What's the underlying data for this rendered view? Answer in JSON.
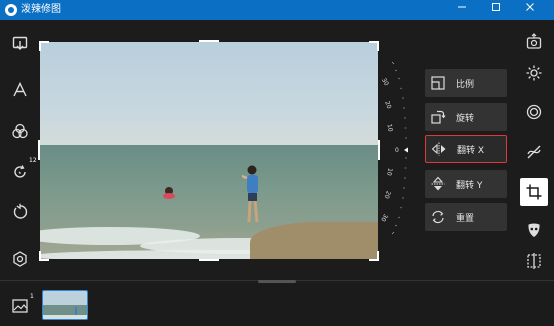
{
  "titlebar": {
    "title": "泼辣修图",
    "minimize_icon": "minimize-icon",
    "maximize_icon": "maximize-icon",
    "close_icon": "close-icon"
  },
  "left_tools": [
    {
      "name": "import-icon"
    },
    {
      "name": "text-icon"
    },
    {
      "name": "filters-icon"
    },
    {
      "name": "history-icon",
      "badge": "12"
    },
    {
      "name": "undo-icon"
    },
    {
      "name": "settings-icon"
    }
  ],
  "right_tools": [
    {
      "name": "export-icon"
    },
    {
      "name": "adjust-icon"
    },
    {
      "name": "effects-icon"
    },
    {
      "name": "curve-icon"
    },
    {
      "name": "crop-icon",
      "selected": true
    },
    {
      "name": "mask-icon"
    },
    {
      "name": "compare-icon"
    }
  ],
  "dial": {
    "labels": [
      "30",
      "20",
      "10",
      "0",
      "10",
      "20",
      "30"
    ],
    "value": "0"
  },
  "transform_buttons": [
    {
      "label": "比例",
      "icon": "aspect-ratio-icon"
    },
    {
      "label": "旋转",
      "icon": "rotate-icon"
    },
    {
      "label": "翻转 X",
      "icon": "flip-horizontal-icon",
      "active": true
    },
    {
      "label": "翻转 Y",
      "icon": "flip-vertical-icon"
    },
    {
      "label": "重置",
      "icon": "reset-icon"
    }
  ],
  "filmstrip": {
    "count_badge": "1",
    "gallery_icon": "gallery-icon"
  },
  "colors": {
    "titlebar": "#0b6fc4",
    "active_border": "#e0393b",
    "selected_thumb": "#2f86d9"
  }
}
